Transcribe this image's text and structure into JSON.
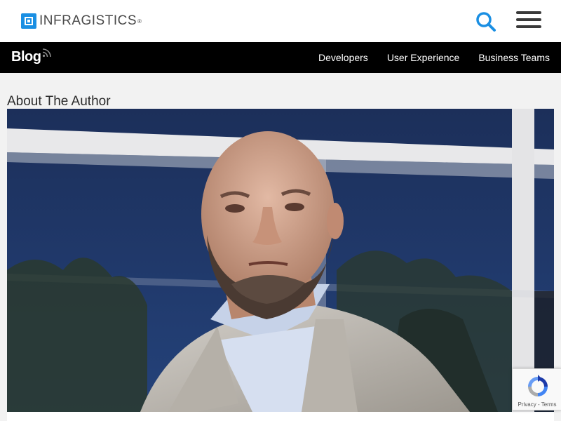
{
  "header": {
    "logo_text": "INFRAGISTICS",
    "logo_tm": "®",
    "search_icon": "search-icon",
    "menu_icon": "hamburger-menu-icon"
  },
  "blog_nav": {
    "title": "Blog",
    "rss_icon": "rss-icon",
    "links": [
      {
        "label": "Developers"
      },
      {
        "label": "User Experience"
      },
      {
        "label": "Business Teams"
      }
    ]
  },
  "main": {
    "section_title": "About The Author"
  },
  "recaptcha": {
    "privacy_label": "Privacy",
    "separator": " - ",
    "terms_label": "Terms"
  },
  "colors": {
    "brand_blue": "#1a8fe3",
    "nav_bg": "#000000",
    "page_bg": "#f2f2f2"
  }
}
